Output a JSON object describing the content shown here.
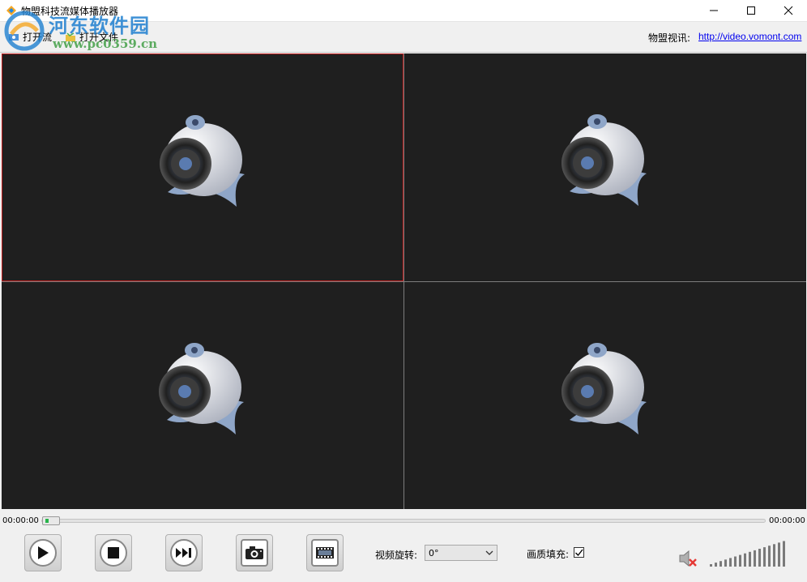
{
  "window": {
    "title": "物盟科技流媒体播放器",
    "controls": {
      "minimize": "minimize",
      "maximize": "maximize",
      "close": "close"
    }
  },
  "toolbar": {
    "open_stream": "打开流",
    "open_file": "打开文件",
    "site_label": "物盟视讯:",
    "site_url": "http://video.vomont.com"
  },
  "watermark": {
    "title": "河东软件园",
    "url": "www.pc0359.cn"
  },
  "video_panes": [
    {
      "id": 1,
      "state": "no-signal",
      "selected": true
    },
    {
      "id": 2,
      "state": "no-signal",
      "selected": false
    },
    {
      "id": 3,
      "state": "no-signal",
      "selected": false
    },
    {
      "id": 4,
      "state": "no-signal",
      "selected": false
    }
  ],
  "playback": {
    "current_time": "00:00:00",
    "total_time": "00:00:00",
    "progress": 0
  },
  "controls": {
    "buttons": [
      "play",
      "stop",
      "step-forward",
      "snapshot",
      "record"
    ],
    "rotation_label": "视频旋转:",
    "rotation_value": "0°",
    "fill_label": "画质填充:",
    "fill_checked": true,
    "muted": true,
    "volume_level": 1.0
  },
  "colors": {
    "pane_background": "#1f1f1f",
    "selected_border": "#c02020",
    "progress_fill": "#27b44a",
    "link": "#0000ee"
  }
}
